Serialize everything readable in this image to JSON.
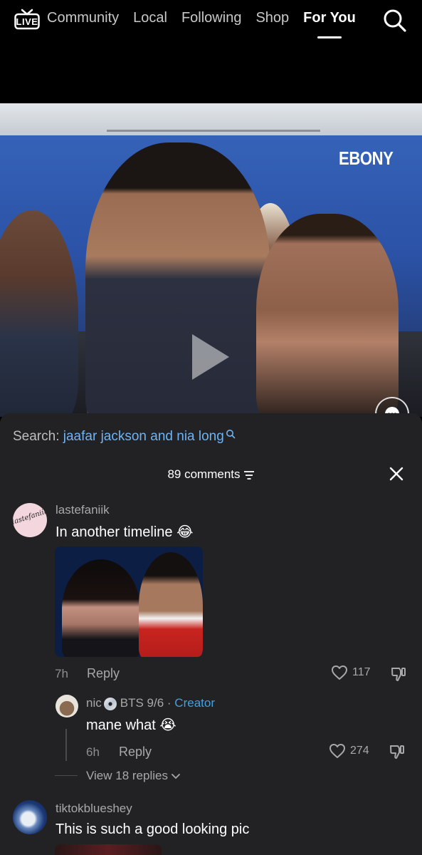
{
  "nav": {
    "live_label": "LIVE",
    "tabs": [
      {
        "label": "Community",
        "active": false
      },
      {
        "label": "Local",
        "active": false
      },
      {
        "label": "Following",
        "active": false
      },
      {
        "label": "Shop",
        "active": false
      },
      {
        "label": "For You",
        "active": true
      }
    ],
    "search_icon": "search-icon"
  },
  "video": {
    "backdrop_text": "EBONY",
    "icons": [
      "play-icon",
      "comment-bubble-icon",
      "plus-icon"
    ]
  },
  "comments_sheet": {
    "search_prefix": "Search: ",
    "search_query": "jaafar jackson and nia long",
    "count_label": "89 comments",
    "close_icon": "close-icon",
    "comments": [
      {
        "username": "lastefaniik",
        "avatar_text": "lastefaniik",
        "text": "In another timeline 😂",
        "time": "7h",
        "reply_label": "Reply",
        "likes": "117",
        "has_image": true
      },
      {
        "username": "nic",
        "username_suffix": "BTS 9/6",
        "separator": "·",
        "badge": "Creator",
        "text": "mane what 😭",
        "time": "6h",
        "reply_label": "Reply",
        "likes": "274"
      },
      {
        "username": "tiktokblueshey",
        "text": "This is such a good looking pic"
      }
    ],
    "view_replies_label": "View 18 replies"
  },
  "colors": {
    "accent_link": "#6fb3f2",
    "creator_badge": "#41a0dd",
    "follow_plus": "#fe2c55",
    "sheet_bg": "#222224"
  }
}
